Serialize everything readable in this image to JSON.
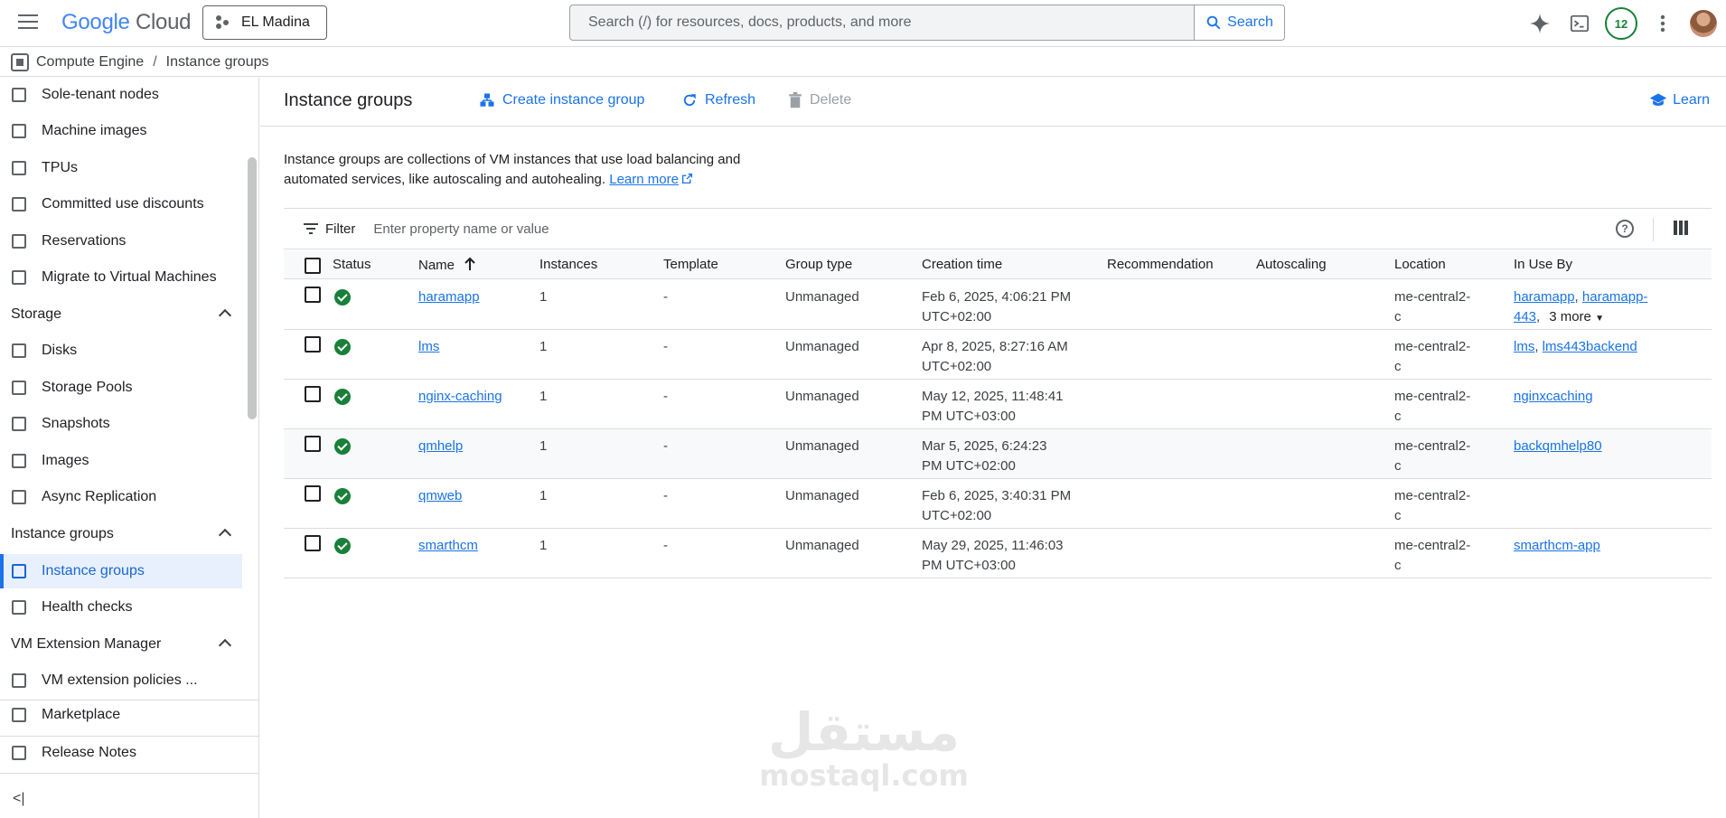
{
  "topbar": {
    "logo_google": "Google",
    "logo_cloud": "Cloud",
    "project_name": "EL Madina",
    "search_placeholder": "Search (/) for resources, docs, products, and more",
    "search_button": "Search",
    "notification_count": "12"
  },
  "breadcrumb": {
    "parent": "Compute Engine",
    "separator": "/",
    "current": "Instance groups"
  },
  "sidebar": {
    "items_top": [
      {
        "label": "Sole-tenant nodes",
        "icon": "sole-tenant-icon"
      },
      {
        "label": "Machine images",
        "icon": "machine-image-icon"
      },
      {
        "label": "TPUs",
        "icon": "tpu-icon"
      },
      {
        "label": "Committed use discounts",
        "icon": "discount-icon"
      },
      {
        "label": "Reservations",
        "icon": "calendar-icon"
      },
      {
        "label": "Migrate to Virtual Machines",
        "icon": "migrate-icon"
      }
    ],
    "storage_section": "Storage",
    "storage_items": [
      {
        "label": "Disks",
        "icon": "disk-icon"
      },
      {
        "label": "Storage Pools",
        "icon": "storage-pool-icon"
      },
      {
        "label": "Snapshots",
        "icon": "snapshot-icon"
      },
      {
        "label": "Images",
        "icon": "image-icon"
      },
      {
        "label": "Async Replication",
        "icon": "replication-icon"
      }
    ],
    "ig_section": "Instance groups",
    "ig_items": [
      {
        "label": "Instance groups",
        "icon": "instance-group-icon",
        "active": true
      },
      {
        "label": "Health checks",
        "icon": "health-check-icon"
      }
    ],
    "vmext_section": "VM Extension Manager",
    "vmext_items": [
      {
        "label": "VM extension policies ...",
        "icon": "policy-icon"
      }
    ],
    "bottom_items": [
      {
        "label": "Marketplace",
        "icon": "marketplace-icon"
      },
      {
        "label": "Release Notes",
        "icon": "release-notes-icon"
      }
    ],
    "collapse": "<|"
  },
  "main": {
    "title": "Instance groups",
    "actions": {
      "create": "Create instance group",
      "refresh": "Refresh",
      "delete": "Delete"
    },
    "learn": "Learn",
    "description": "Instance groups are collections of VM instances that use load balancing and automated services, like autoscaling and autohealing.",
    "learn_more": "Learn more"
  },
  "table": {
    "filter_label": "Filter",
    "filter_placeholder": "Enter property name or value",
    "columns": {
      "status": "Status",
      "name": "Name",
      "instances": "Instances",
      "template": "Template",
      "group_type": "Group type",
      "creation_time": "Creation time",
      "recommendation": "Recommendation",
      "autoscaling": "Autoscaling",
      "location": "Location",
      "in_use_by": "In Use By"
    },
    "rows": [
      {
        "name": "haramapp",
        "instances": "1",
        "template": "-",
        "group_type": "Unmanaged",
        "created_1": "Feb 6, 2025, 4:06:21 PM",
        "created_2": "UTC+02:00",
        "location_1": "me-central2-",
        "location_2": "c",
        "in_use_1": "haramapp",
        "in_use_sep": ", ",
        "in_use_2": "haramapp-",
        "in_use_3": "443",
        "in_use_more": "3 more"
      },
      {
        "name": "lms",
        "instances": "1",
        "template": "-",
        "group_type": "Unmanaged",
        "created_1": "Apr 8, 2025, 8:27:16 AM",
        "created_2": "UTC+02:00",
        "location_1": "me-central2-",
        "location_2": "c",
        "in_use_1": "lms",
        "in_use_sep": ", ",
        "in_use_2": "lms443backend"
      },
      {
        "name": "nginx-caching",
        "instances": "1",
        "template": "-",
        "group_type": "Unmanaged",
        "created_1": "May 12, 2025, 11:48:41",
        "created_2": "PM UTC+03:00",
        "location_1": "me-central2-",
        "location_2": "c",
        "in_use_1": "nginxcaching"
      },
      {
        "name": "qmhelp",
        "instances": "1",
        "template": "-",
        "group_type": "Unmanaged",
        "created_1": "Mar 5, 2025, 6:24:23",
        "created_2": "PM UTC+02:00",
        "location_1": "me-central2-",
        "location_2": "c",
        "in_use_1": "backqmhelp80"
      },
      {
        "name": "qmweb",
        "instances": "1",
        "template": "-",
        "group_type": "Unmanaged",
        "created_1": "Feb 6, 2025, 3:40:31 PM",
        "created_2": "UTC+02:00",
        "location_1": "me-central2-",
        "location_2": "c",
        "in_use_1": ""
      },
      {
        "name": "smarthcm",
        "instances": "1",
        "template": "-",
        "group_type": "Unmanaged",
        "created_1": "May 29, 2025, 11:46:03",
        "created_2": "PM UTC+03:00",
        "location_1": "me-central2-",
        "location_2": "c",
        "in_use_1": "smarthcm-app"
      }
    ]
  },
  "watermark": {
    "arabic": "مستقل",
    "latin": "mostaql.com"
  },
  "colors": {
    "accent": "#1a73e8",
    "status_ok": "#188038",
    "active_bg": "#e8f0fe"
  }
}
